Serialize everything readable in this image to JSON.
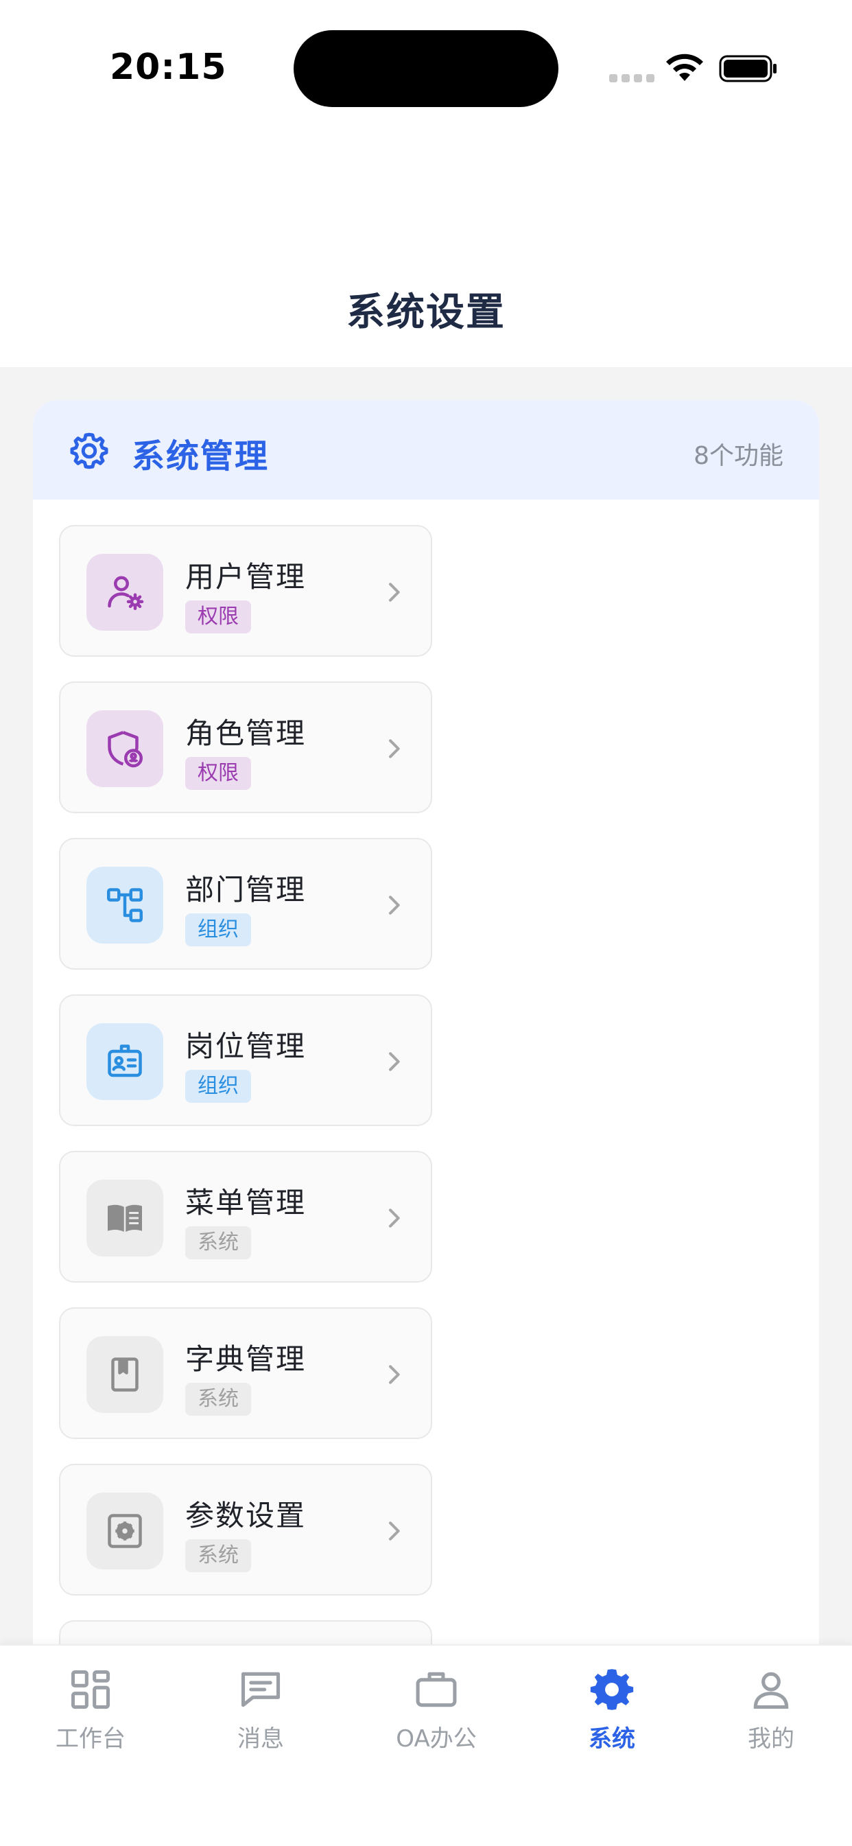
{
  "status_bar": {
    "time": "20:15"
  },
  "header": {
    "title": "系统设置"
  },
  "section": {
    "title": "系统管理",
    "count": "8个功能",
    "icon": "gear-icon",
    "accent_color": "#2b62e6"
  },
  "items": [
    {
      "title": "用户管理",
      "tag": "权限",
      "icon": "user-settings-icon",
      "theme": "purple"
    },
    {
      "title": "角色管理",
      "tag": "权限",
      "icon": "shield-user-icon",
      "theme": "purple"
    },
    {
      "title": "部门管理",
      "tag": "组织",
      "icon": "org-tree-icon",
      "theme": "blue"
    },
    {
      "title": "岗位管理",
      "tag": "组织",
      "icon": "badge-icon",
      "theme": "blue"
    },
    {
      "title": "菜单管理",
      "tag": "系统",
      "icon": "book-open-icon",
      "theme": "gray"
    },
    {
      "title": "字典管理",
      "tag": "系统",
      "icon": "bookmark-book-icon",
      "theme": "gray"
    },
    {
      "title": "参数设置",
      "tag": "系统",
      "icon": "settings-box-icon",
      "theme": "gray"
    }
  ],
  "tabs": [
    {
      "label": "工作台",
      "icon": "dashboard-icon",
      "active": false
    },
    {
      "label": "消息",
      "icon": "message-icon",
      "active": false
    },
    {
      "label": "OA办公",
      "icon": "briefcase-icon",
      "active": false
    },
    {
      "label": "系统",
      "icon": "gear-icon",
      "active": true
    },
    {
      "label": "我的",
      "icon": "user-icon",
      "active": false
    }
  ],
  "colors": {
    "purple_tag_bg": "#ecdcef",
    "purple_tag_text": "#9a3bb0",
    "blue_tag_bg": "#d9ebfb",
    "blue_tag_text": "#2a8ee0",
    "gray_tag_bg": "#ececec",
    "gray_tag_text": "#a0a0a0",
    "tab_inactive": "#9aa0a6"
  }
}
